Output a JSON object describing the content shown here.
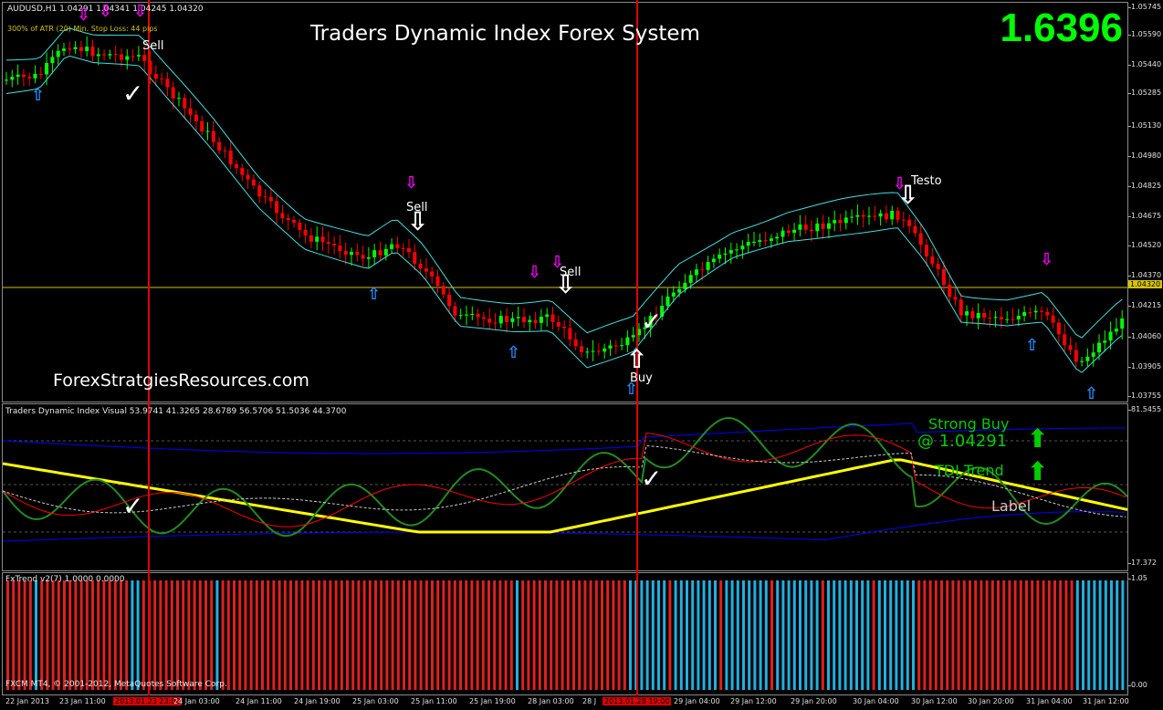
{
  "main": {
    "symbol_info": "AUDUSD,H1  1.04291 1.04341 1.04245 1.04320",
    "atr_info": "300% of ATR (20)    Min. Stop Loss:  44 pips",
    "title": "Traders Dynamic Index Forex System",
    "big_price": "1.6396",
    "website": "ForexStratgiesResources.com",
    "current_price_tag": "1.04320",
    "price_axis": [
      "1.05745",
      "1.05590",
      "1.05440",
      "1.05285",
      "1.05130",
      "1.04980",
      "1.04825",
      "1.04675",
      "1.04520",
      "1.04370",
      "1.04215",
      "1.04060",
      "1.03905",
      "1.03755"
    ],
    "signal_labels": {
      "sell_1": "Sell",
      "sell_2": "Sell",
      "sell_3": "Sell",
      "buy_1": "Buy",
      "testo": "Testo"
    }
  },
  "tdi": {
    "title": "Traders Dynamic Index Visual 53.9741 41.3265 28.6789 56.5706 51.5036 44.3700",
    "axis_top": "81.5455",
    "axis_bottom": "17.372",
    "strong_buy": "Strong Buy",
    "price_text": "@ 1.04291",
    "trend_text": "TDI Trend",
    "label_text": "Label"
  },
  "fx": {
    "title": "FxTrend v2(7) 1.0000 0.0000",
    "axis_top": "1.05",
    "axis_bottom": "0.00",
    "copyright": "FXCM MT4, © 2001-2012, MetaQuotes Software Corp."
  },
  "time_axis": [
    {
      "label": "22 Jan 2013",
      "hl": false
    },
    {
      "label": "23 Jan 11:00",
      "hl": false
    },
    {
      "label": "2013.01.23 23:00",
      "hl": true
    },
    {
      "label": "24 Jan 03:00",
      "hl": false
    },
    {
      "label": "24 Jan 11:00",
      "hl": false
    },
    {
      "label": "24 Jan 19:00",
      "hl": false
    },
    {
      "label": "25 Jan 03:00",
      "hl": false
    },
    {
      "label": "25 Jan 11:00",
      "hl": false
    },
    {
      "label": "25 Jan 19:00",
      "hl": false
    },
    {
      "label": "28 Jan 03:00",
      "hl": false
    },
    {
      "label": "28 J",
      "hl": false
    },
    {
      "label": "2013.01.28 19:00",
      "hl": true
    },
    {
      "label": "29 Jan 04:00",
      "hl": false
    },
    {
      "label": "29 Jan 12:00",
      "hl": false
    },
    {
      "label": "29 Jan 20:00",
      "hl": false
    },
    {
      "label": "30 Jan 04:00",
      "hl": false
    },
    {
      "label": "30 Jan 12:00",
      "hl": false
    },
    {
      "label": "30 Jan 20:00",
      "hl": false
    },
    {
      "label": "31 Jan 04:00",
      "hl": false
    },
    {
      "label": "31 Jan 12:00",
      "hl": false
    }
  ],
  "colors": {
    "bull": "#00ff00",
    "bear": "#ff0000",
    "band": "#40e0e0",
    "tdi_yellow": "#ffff00",
    "tdi_blue": "#0000ff",
    "tdi_green": "#228b22",
    "tdi_red": "#ff0000",
    "fx_red": "#e02020",
    "fx_blue": "#20b0e0"
  }
}
